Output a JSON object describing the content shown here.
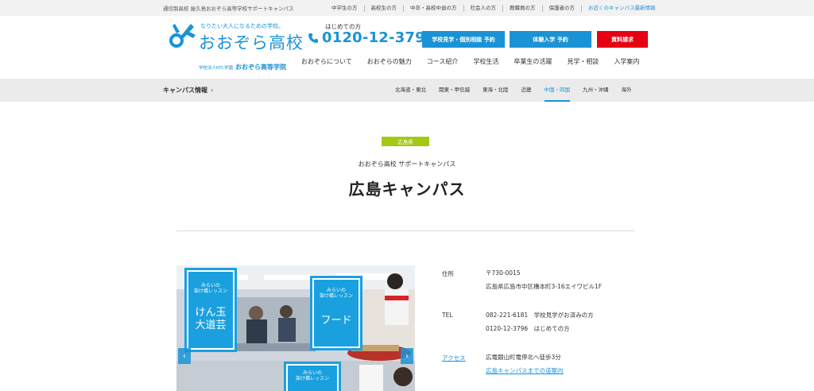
{
  "topbar": {
    "tagline": "通信制高校 屋久島おおぞら高等学校サポートキャンパス",
    "links": [
      "中学生の方",
      "高校生の方",
      "中卒・高校中退の方",
      "社会人の方",
      "教職員の方",
      "保護者の方",
      "お近くのキャンパス最新情報"
    ]
  },
  "logo": {
    "slogan": "なりたい大人になるための学校。",
    "name": "おおぞら高校",
    "sub_small": "学校法人KTC学園",
    "sub_bold": "おおぞら高等学院"
  },
  "phone": {
    "label": "はじめての方",
    "number": "0120-12-3796"
  },
  "buttons": {
    "visit": "学校見学・個別相談 予約",
    "trial": "体験入学 予約",
    "docs": "資料請求"
  },
  "nav": [
    "おおぞらについて",
    "おおぞらの魅力",
    "コース紹介",
    "学校生活",
    "卒業生の活躍",
    "見学・相談",
    "入学案内"
  ],
  "campus_bar": {
    "title": "キャンパス情報",
    "chevron": "›",
    "regions": [
      "北海道・東北",
      "関東・甲信越",
      "東海・北陸",
      "近畿",
      "中国・四国",
      "九州・沖縄",
      "海外"
    ],
    "active_region": "中国・四国"
  },
  "page": {
    "prefecture": "広島県",
    "subtitle": "おおぞら高校 サポートキャンパス",
    "title": "広島キャンパス"
  },
  "photo": {
    "cards": [
      {
        "small": "みらいの\n架け橋レッスン",
        "big": "けん玉\n大道芸"
      },
      {
        "small": "みらいの\n架け橋レッスン",
        "big": "フード"
      },
      {
        "small": "みらいの\n架け橋レッスン"
      }
    ],
    "prev": "‹",
    "next": "›"
  },
  "info": {
    "address_label": "住所",
    "postal": "〒730-0015",
    "address": "広島県広島市中区橋本町3-16エイワビル1F",
    "tel_label": "TEL",
    "tel1": "082-221-6181　学校見学がお済みの方",
    "tel2": "0120-12-3796　はじめての方",
    "access_label": "アクセス",
    "access": "広電銀山町電停北へ徒歩3分",
    "access_link": "広島キャンパスまでの道案内"
  },
  "colors": {
    "brand": "#1a93d6",
    "badge": "#a4c913",
    "red": "#e60012"
  }
}
